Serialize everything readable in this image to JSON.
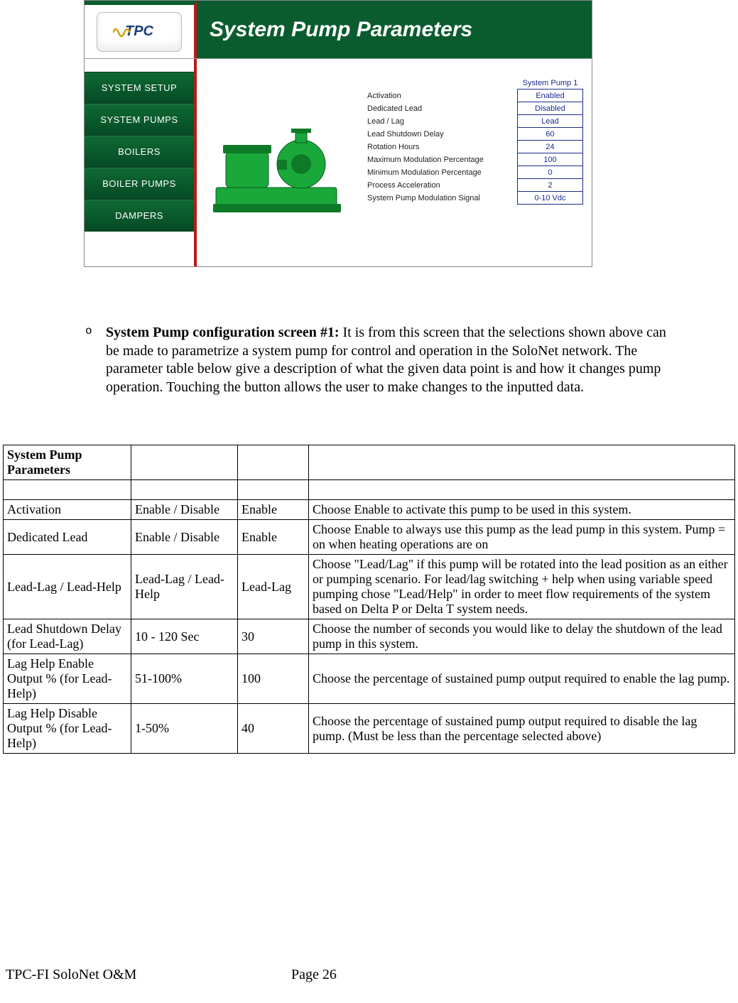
{
  "ui": {
    "logo_text": "TPC",
    "title": "System Pump Parameters",
    "nav": [
      "SYSTEM SETUP",
      "SYSTEM PUMPS",
      "BOILERS",
      "BOILER PUMPS",
      "DAMPERS"
    ],
    "column_header": "System Pump 1",
    "params": [
      {
        "label": "Activation",
        "value": "Enabled"
      },
      {
        "label": "Dedicated Lead",
        "value": "Disabled"
      },
      {
        "label": "Lead / Lag",
        "value": "Lead"
      },
      {
        "label": "Lead Shutdown Delay",
        "value": "60"
      },
      {
        "label": "Rotation Hours",
        "value": "24"
      },
      {
        "label": "Maximum Modulation Percentage",
        "value": "100"
      },
      {
        "label": "Minimum Modulation Percentage",
        "value": "0"
      },
      {
        "label": "Process Acceleration",
        "value": "2"
      },
      {
        "label": "System Pump Modulation Signal",
        "value": "0-10 Vdc"
      }
    ]
  },
  "paragraph": {
    "marker": "o",
    "bold": "System Pump configuration screen #1:",
    "rest": "  It is from this screen that the selections shown above can be made to parametrize a system pump for control and operation in the SoloNet network.  The parameter table below give a description of what the given data point is and how it changes pump operation.  Touching the button allows the user to make changes to the inputted data."
  },
  "table": {
    "header_cell": "System Pump Parameters",
    "rows": [
      {
        "c1": "Activation",
        "c2": "Enable / Disable",
        "c3": "Enable",
        "c4": "Choose Enable to activate this pump to be used in this system."
      },
      {
        "c1": "Dedicated Lead",
        "c2": "Enable / Disable",
        "c3": "Enable",
        "c4": "Choose Enable to always use this pump as the lead pump in this system.  Pump = on when heating operations are on"
      },
      {
        "c1": "Lead-Lag / Lead-Help",
        "c2": "Lead-Lag / Lead-Help",
        "c3": "Lead-Lag",
        "c4": "Choose \"Lead/Lag\" if this pump will be rotated into the lead position as an either or pumping scenario.  For lead/lag switching + help when using variable speed pumping chose \"Lead/Help\" in order to meet flow requirements of the system based on Delta P or Delta T system needs."
      },
      {
        "c1": "Lead Shutdown Delay (for Lead-Lag)",
        "c2": "10 - 120 Sec",
        "c3": "30",
        "c4": "Choose the number of seconds you would like to delay the shutdown of the lead pump in this system."
      },
      {
        "c1": "Lag Help Enable Output % (for Lead-Help)",
        "c2": "51-100%",
        "c3": "100",
        "c4": "Choose the percentage of sustained pump output required to enable the lag pump."
      },
      {
        "c1": "Lag Help Disable Output % (for Lead-Help)",
        "c2": "1-50%",
        "c3": "40",
        "c4": "Choose the percentage of sustained pump output required to disable the lag pump.  (Must be less than the percentage selected above)"
      }
    ]
  },
  "footer": {
    "left": "TPC-FI SoloNet O&M",
    "center": "Page 26"
  }
}
